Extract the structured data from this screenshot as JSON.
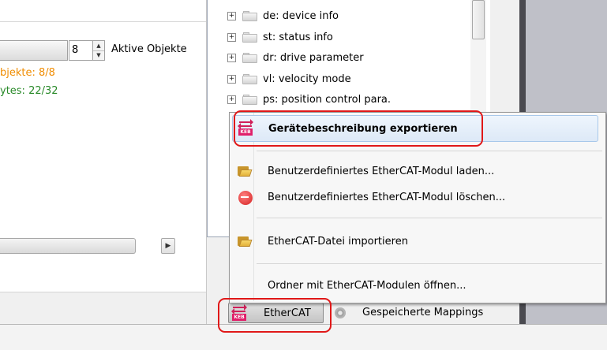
{
  "left_panel": {
    "object_count": "8",
    "active_objects_label": "Aktive Objekte",
    "objects_status": "bjekte: 8/8",
    "bytes_status": "ytes: 22/32",
    "colors": {
      "objects_status": "#f08c00",
      "bytes_status": "#2a8a2a"
    }
  },
  "tree": {
    "items": [
      {
        "label": "de: device info"
      },
      {
        "label": "st: status info"
      },
      {
        "label": "dr: drive parameter"
      },
      {
        "label": "vl: velocity mode"
      },
      {
        "label": "ps: position control para."
      }
    ]
  },
  "context_menu": {
    "items": [
      {
        "label": "Gerätebeschreibung exportieren",
        "icon": "ethercat-exchange-icon",
        "highlighted": true
      },
      {
        "label": "Benutzerdefiniertes EtherCAT-Modul laden...",
        "icon": "folder-open-icon"
      },
      {
        "label": "Benutzerdefiniertes EtherCAT-Modul löschen...",
        "icon": "delete-icon"
      },
      {
        "label": "EtherCAT-Datei importieren",
        "icon": "folder-open-icon"
      },
      {
        "label": "Ordner mit EtherCAT-Modulen öffnen..."
      }
    ]
  },
  "bottom_tabs": {
    "ethercat_label": "EtherCAT",
    "mappings_label": "Gespeicherte Mappings"
  },
  "icon_badge": "KEB",
  "colors": {
    "highlight_outline": "#e01818",
    "menu_highlight": "#dde9f7",
    "ethercat_icon": "#d0205a"
  }
}
